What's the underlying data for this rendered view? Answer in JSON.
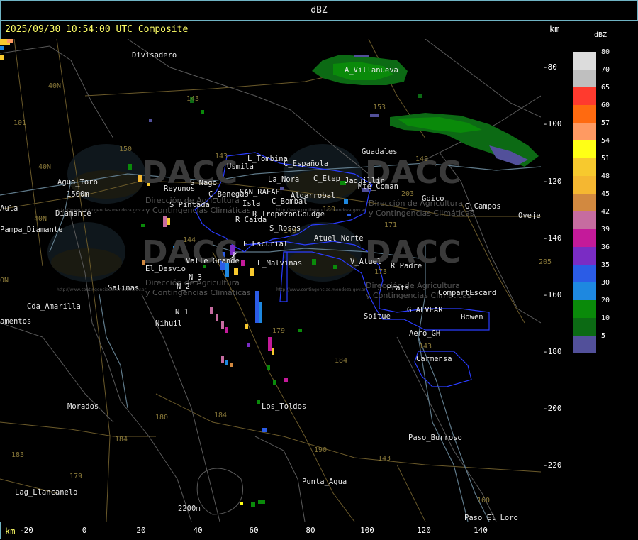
{
  "header": {
    "title": "dBZ"
  },
  "map": {
    "timestamp": "2025/09/30 10:54:00 UTC Composite",
    "unit_top": "km",
    "unit_bottom": "km",
    "x_ticks": [
      "-20",
      "0",
      "20",
      "40",
      "60",
      "80",
      "100",
      "120",
      "140"
    ],
    "y_ticks": [
      "-80",
      "-100",
      "-120",
      "-140",
      "-160",
      "-180",
      "-200",
      "-220"
    ],
    "watermark": {
      "brand": "DACC",
      "line1": "Dirección de Agricultura",
      "line2": "y Contingencias Climáticas",
      "url": "http://www.contingencias.mendoza.gov.ar"
    },
    "places": [
      "Divisadero",
      "A_Villanueva",
      "Guadales",
      "Usmila",
      "L_Tombina",
      "C_Española",
      "C_Etep",
      "Jaquillín",
      "Mte_Coman",
      "Goico",
      "G_Campos",
      "Oveje",
      "Agua_Toro",
      "Reyunos",
      "S_Nago",
      "C_Benegas",
      "SAN_RAFAEL",
      "La_Nora",
      "Algarrobal",
      "C_Bombal",
      "S_Pintada",
      "Isla",
      "R_Tropezon",
      "Goudge",
      "R_Caida",
      "S_Rosas",
      "Atuel_Norte",
      "E_Escurial",
      "Pampa_Diamante",
      "El_Desvio",
      "Valle_Grande",
      "L_Malvinas",
      "V_Atuel",
      "R_Padre",
      "Salinas",
      "N_3",
      "N_2",
      "J_Prats",
      "CompartEscard",
      "Cda_Amarilla",
      "N_1",
      "G_ALVEAR",
      "Bowen",
      "Nihuil",
      "Soitue",
      "Aero_GH",
      "Carmensa",
      "Morados",
      "Los_Toldos",
      "Paso_Burroso",
      "Lag_Llancanelo",
      "Punta_Agua",
      "Paso_El_Loro",
      "Aula",
      "Diamante",
      "amentos",
      "1500m",
      "2200m"
    ],
    "roads": [
      "153",
      "143",
      "101",
      "40N",
      "40N",
      "40N",
      "150",
      "143",
      "148",
      "203",
      "171",
      "173",
      "144",
      "143",
      "180",
      "205",
      "179",
      "184",
      "143",
      "180",
      "184",
      "184",
      "183",
      "179",
      "190",
      "143",
      "160",
      "ON"
    ]
  },
  "legend": {
    "title": "dBZ",
    "entries": [
      {
        "label": "80",
        "color": "#dcdcdc"
      },
      {
        "label": "70",
        "color": "#bfbfbf"
      },
      {
        "label": "65",
        "color": "#ff3a2e"
      },
      {
        "label": "60",
        "color": "#ff6a10"
      },
      {
        "label": "57",
        "color": "#ff9a62"
      },
      {
        "label": "54",
        "color": "#ffff16"
      },
      {
        "label": "51",
        "color": "#f7c92e"
      },
      {
        "label": "48",
        "color": "#f5b731"
      },
      {
        "label": "45",
        "color": "#d28940"
      },
      {
        "label": "42",
        "color": "#c66ca0"
      },
      {
        "label": "39",
        "color": "#c41a9a"
      },
      {
        "label": "36",
        "color": "#7a2cc4"
      },
      {
        "label": "35",
        "color": "#2b5ce6"
      },
      {
        "label": "30",
        "color": "#1e88e0"
      },
      {
        "label": "20",
        "color": "#0a8a0a"
      },
      {
        "label": "10",
        "color": "#0c6a14"
      },
      {
        "label": "5",
        "color": "#52509a"
      }
    ]
  }
}
